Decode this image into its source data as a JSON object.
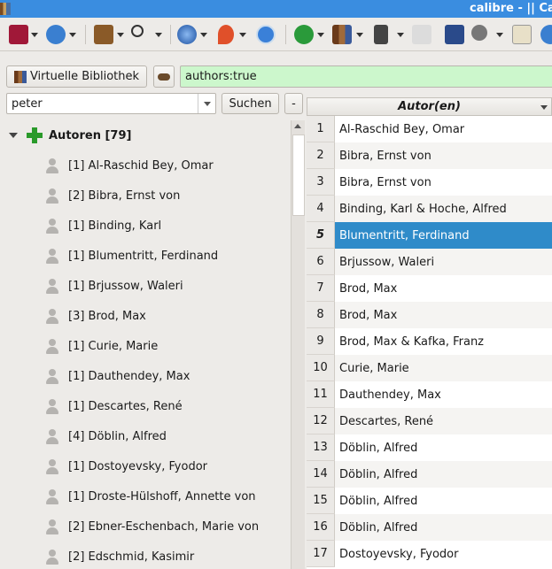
{
  "window": {
    "title": "calibre - || Ca"
  },
  "toolbar": {
    "icons": [
      "add-book",
      "book-info",
      "convert",
      "search",
      "fetch-news",
      "news",
      "help",
      "remove",
      "library",
      "device",
      "connect-share",
      "edit-metadata",
      "preferences",
      "text",
      "info"
    ]
  },
  "virtual_library": {
    "label": "Virtuelle Bibliothek",
    "search_value": "authors:true"
  },
  "tag_browser": {
    "search_value": "peter",
    "search_button": "Suchen",
    "collapse_button": "-",
    "category": "Autoren [79]",
    "items": [
      "[1] Al-Raschid Bey, Omar",
      "[2] Bibra, Ernst von",
      "[1] Binding, Karl",
      "[1] Blumentritt, Ferdinand",
      "[1] Brjussow, Waleri",
      "[3] Brod, Max",
      "[1] Curie, Marie",
      "[1] Dauthendey, Max",
      "[1] Descartes, René",
      "[4] Döblin, Alfred",
      "[1] Dostoyevsky, Fyodor",
      "[1] Droste-Hülshoff, Annette von",
      "[2] Ebner-Eschenbach, Marie von",
      "[2] Edschmid, Kasimir"
    ]
  },
  "book_list": {
    "column_header": "Autor(en)",
    "selected_row": 5,
    "rows": [
      {
        "n": "1",
        "author": "Al-Raschid Bey, Omar"
      },
      {
        "n": "2",
        "author": "Bibra, Ernst von"
      },
      {
        "n": "3",
        "author": "Bibra, Ernst von"
      },
      {
        "n": "4",
        "author": "Binding, Karl & Hoche, Alfred"
      },
      {
        "n": "5",
        "author": "Blumentritt, Ferdinand"
      },
      {
        "n": "6",
        "author": "Brjussow, Waleri"
      },
      {
        "n": "7",
        "author": "Brod, Max"
      },
      {
        "n": "8",
        "author": "Brod, Max"
      },
      {
        "n": "9",
        "author": "Brod, Max & Kafka, Franz"
      },
      {
        "n": "10",
        "author": "Curie, Marie"
      },
      {
        "n": "11",
        "author": "Dauthendey, Max"
      },
      {
        "n": "12",
        "author": "Descartes, René"
      },
      {
        "n": "13",
        "author": "Döblin, Alfred"
      },
      {
        "n": "14",
        "author": "Döblin, Alfred"
      },
      {
        "n": "15",
        "author": "Döblin, Alfred"
      },
      {
        "n": "16",
        "author": "Döblin, Alfred"
      },
      {
        "n": "17",
        "author": "Dostoyevsky, Fyodor"
      }
    ]
  }
}
